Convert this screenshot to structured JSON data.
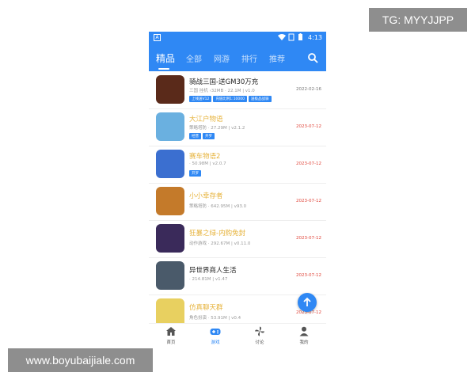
{
  "watermarks": {
    "top": "TG: MYYJJPP",
    "bottom": "www.boyubaijiale.com"
  },
  "status_bar": {
    "time": "4:13",
    "left_icon": "A"
  },
  "tabs": [
    {
      "label": "精品"
    },
    {
      "label": "全部"
    },
    {
      "label": "网游"
    },
    {
      "label": "排行"
    },
    {
      "label": "推荐"
    }
  ],
  "apps": [
    {
      "title": "骑战三国-送GM30万充",
      "title_color": "#222222",
      "meta": "三国 挂机 ›32MB · 22.1M | v1.0",
      "tags": [
        "上线送V12",
        "充值比例1:10000",
        "送极品战骑"
      ],
      "date": "2022-02-16",
      "date_color": "#777777",
      "icon_color": "#5a2a1a"
    },
    {
      "title": "大江户物语",
      "title_color": "#e6b23a",
      "meta": "策略塔防 · 27.29M | v2.1.2",
      "tags": [
        "经营",
        "开罗"
      ],
      "date": "2023-07-12",
      "date_color": "#e0453a",
      "icon_color": "#6ab0e0"
    },
    {
      "title": "赛车物语2",
      "title_color": "#e6b23a",
      "meta": "· 50.98M | v2.0.7",
      "tags": [
        "开罗"
      ],
      "date": "2023-07-12",
      "date_color": "#e0453a",
      "icon_color": "#3b6fd0"
    },
    {
      "title": "小小幸存者",
      "title_color": "#e6b23a",
      "meta": "策略塔防 · 642.95M | v93.0",
      "tags": [],
      "date": "2023-07-12",
      "date_color": "#e0453a",
      "icon_color": "#c47a2a"
    },
    {
      "title": "狂暴之绿-内购免封",
      "title_color": "#e6b23a",
      "meta": "动作游戏 · 292.67M | v0.11.0",
      "tags": [],
      "date": "2023-07-12",
      "date_color": "#e0453a",
      "icon_color": "#3a2a5a"
    },
    {
      "title": "异世界商人生活",
      "title_color": "#222222",
      "meta": "· 214.81M | v1.47",
      "tags": [],
      "date": "2023-07-12",
      "date_color": "#e0453a",
      "icon_color": "#4a5a6a"
    },
    {
      "title": "仿真聊天群",
      "title_color": "#e6b23a",
      "meta": "角色扮演 · 53.91M | v0.4",
      "tags": [],
      "date": "2023-07-12",
      "date_color": "#e0453a",
      "icon_color": "#e8d060"
    }
  ],
  "bottom_nav": [
    {
      "label": "首页",
      "icon": "home-icon"
    },
    {
      "label": "游戏",
      "icon": "gamepad-icon"
    },
    {
      "label": "讨论",
      "icon": "pinwheel-icon"
    },
    {
      "label": "我的",
      "icon": "person-icon"
    }
  ],
  "colors": {
    "brand": "#2f88f4",
    "tag": "#2f88f4",
    "highlight_title": "#e6b23a",
    "date_new": "#e0453a"
  }
}
